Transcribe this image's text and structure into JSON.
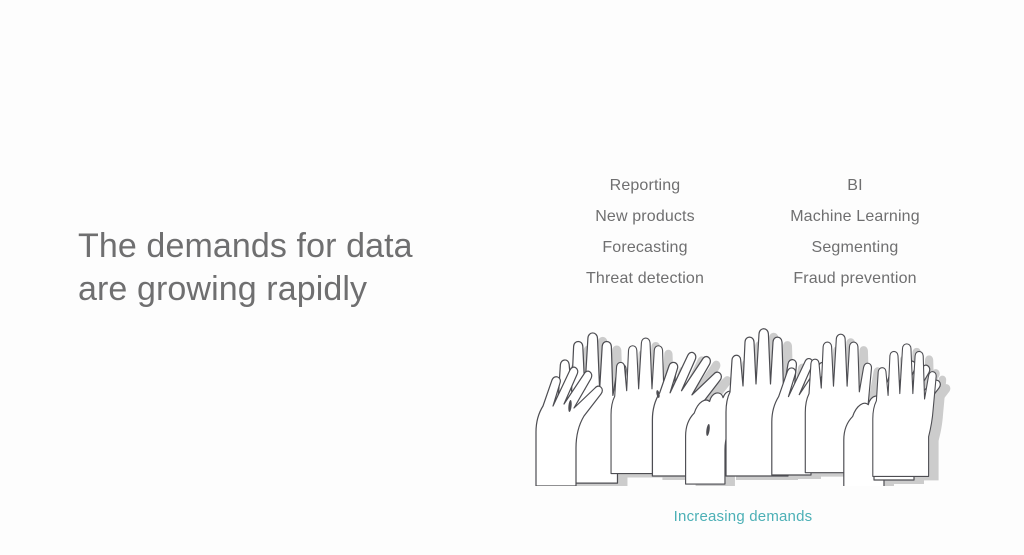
{
  "slide": {
    "background_color": "#fdfdfd",
    "headline": "The demands for data\nare growing rapidly",
    "headline_color": "#6f6f70"
  },
  "word_columns": {
    "text_color": "#6f6f70",
    "left": {
      "items": [
        "Reporting",
        "New products",
        "Forecasting",
        "Threat detection"
      ]
    },
    "right": {
      "items": [
        "BI",
        "Machine Learning",
        "Segmenting",
        "Fraud prevention"
      ]
    }
  },
  "illustration": {
    "name": "raised-hands-illustration",
    "outline_color": "#4d4d52",
    "silhouette_color": "#cccccc"
  },
  "caption": {
    "text": "Increasing demands",
    "color": "#4cb0b6"
  }
}
